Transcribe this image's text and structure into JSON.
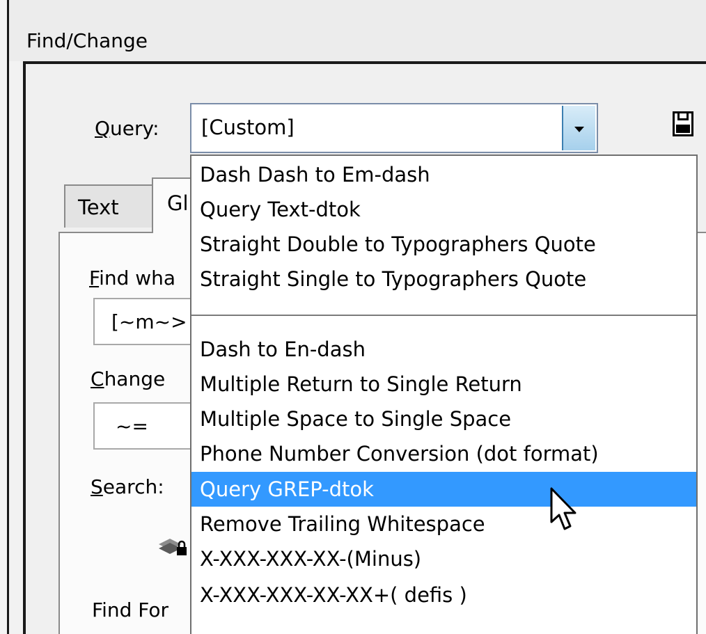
{
  "window": {
    "title": "Find/Change"
  },
  "query": {
    "label": "Query:",
    "label_accel": "Q",
    "label_rest": "uery:",
    "value": "[Custom]",
    "save_icon": "floppy-disk-icon"
  },
  "tabs": [
    {
      "label": "Text"
    },
    {
      "label": "Gl"
    }
  ],
  "panel": {
    "find_what_label_accel": "F",
    "find_what_label_rest": "ind wha",
    "find_what_value": "[~m~>",
    "change_to_label_accel": "C",
    "change_to_label_rest": "hange",
    "change_to_value": "~=",
    "search_label_accel": "S",
    "search_label_rest": "earch:",
    "find_format_label": "Find For",
    "locked_layers_icon": "locked-layers-icon"
  },
  "menu": {
    "group1": [
      "Dash Dash to Em-dash",
      "Query Text-dtok",
      "Straight Double to Typographers Quote",
      "Straight Single to Typographers Quote"
    ],
    "group2": [
      "Dash to En-dash",
      "Multiple Return to Single Return",
      "Multiple Space to Single Space",
      "Phone Number Conversion (dot format)",
      "Query GREP-dtok",
      "Remove Trailing Whitespace",
      "X-XXX-XXX-XX-(Minus)",
      "X-XXX-XXX-XX-XX+( defis )"
    ],
    "selected": "Query GREP-dtok"
  },
  "colors": {
    "selection": "#3399ff",
    "dropdown_button": "#a6d0ec"
  }
}
